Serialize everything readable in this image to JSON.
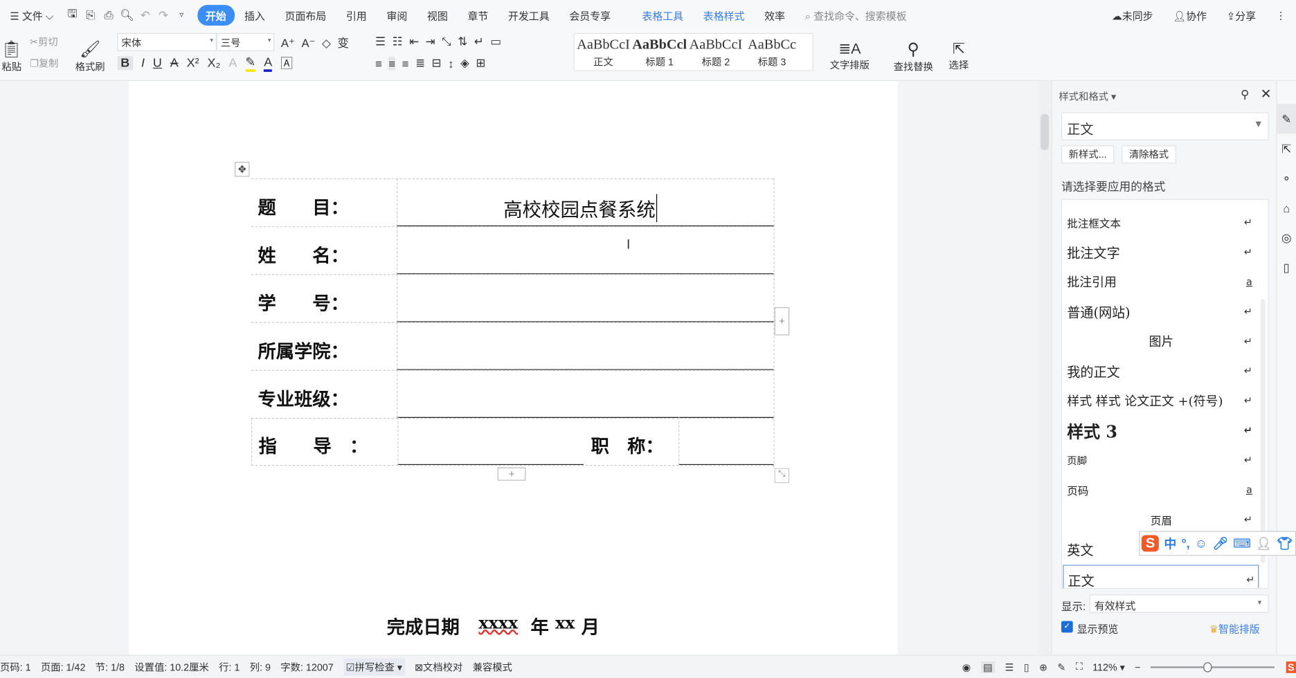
{
  "menubar": {
    "file": "文件",
    "tabs": [
      "开始",
      "插入",
      "页面布局",
      "引用",
      "审阅",
      "视图",
      "章节",
      "开发工具",
      "会员专享",
      "表格工具",
      "表格样式",
      "效率"
    ],
    "search_placeholder": "查找命令、搜索模板",
    "sync": "未同步",
    "collab": "协作",
    "share": "分享"
  },
  "ribbon": {
    "paste": "粘贴",
    "cut": "剪切",
    "copy": "复制",
    "format_painter": "格式刷",
    "font": "宋体",
    "size": "三号",
    "styles": [
      {
        "preview": "AaBbCcI",
        "label": "正文"
      },
      {
        "preview": "AaBbCcl",
        "label": "标题 1"
      },
      {
        "preview": "AaBbCcI",
        "label": "标题 2"
      },
      {
        "preview": "AaBbCc",
        "label": "标题 3"
      }
    ],
    "text_layout": "文字排版",
    "find_replace": "查找替换",
    "select": "选择"
  },
  "document": {
    "rows": [
      {
        "label": "题　　目：",
        "value": "高校校园点餐系统"
      },
      {
        "label": "姓　　名：",
        "value": ""
      },
      {
        "label": "学　　号：",
        "value": ""
      },
      {
        "label": "所属学院：",
        "value": ""
      },
      {
        "label": "专业班级：",
        "value": ""
      },
      {
        "label": "指　　导　：",
        "value": "",
        "extra_label": "职　称：",
        "extra_value": ""
      }
    ],
    "date_label": "完成日期",
    "year_value": "xxxx",
    "year": "年",
    "month_value": "xx",
    "month": "月",
    "add": "+"
  },
  "side_panel": {
    "title": "样式和格式",
    "current_style": "正文",
    "new_style": "新样式...",
    "clear_format": "清除格式",
    "prompt": "请选择要应用的格式",
    "styles": [
      {
        "name": "批注框文本",
        "mark": "↵"
      },
      {
        "name": "批注文字",
        "mark": "↵"
      },
      {
        "name": "批注引用",
        "mark": "a"
      },
      {
        "name": "普通(网站)",
        "mark": "↵"
      },
      {
        "name": "图片",
        "mark": "↵"
      },
      {
        "name": "我的正文",
        "mark": "↵"
      },
      {
        "name": "样式 样式 论文正文 +(符号)",
        "mark": "↵"
      },
      {
        "name": "样式 3",
        "mark": "↵"
      },
      {
        "name": "页脚",
        "mark": "↵"
      },
      {
        "name": "页码",
        "mark": "a"
      },
      {
        "name": "页眉",
        "mark": "↵"
      },
      {
        "name": "英文",
        "mark": ""
      },
      {
        "name": "正文",
        "mark": "↵"
      }
    ],
    "show_label": "显示:",
    "show_value": "有效样式",
    "preview_label": "显示预览",
    "smart_layout": "智能排版"
  },
  "ime": {
    "lang": "中",
    "punct": "°,"
  },
  "status": {
    "page_num": "页码: 1",
    "page": "页面: 1/42",
    "section": "节: 1/8",
    "setting": "设置值: 10.2厘米",
    "line": "行: 1",
    "col": "列: 9",
    "words": "字数: 12007",
    "spell": "拼写检查",
    "proof": "文档校对",
    "compat": "兼容模式",
    "zoom": "112%"
  }
}
